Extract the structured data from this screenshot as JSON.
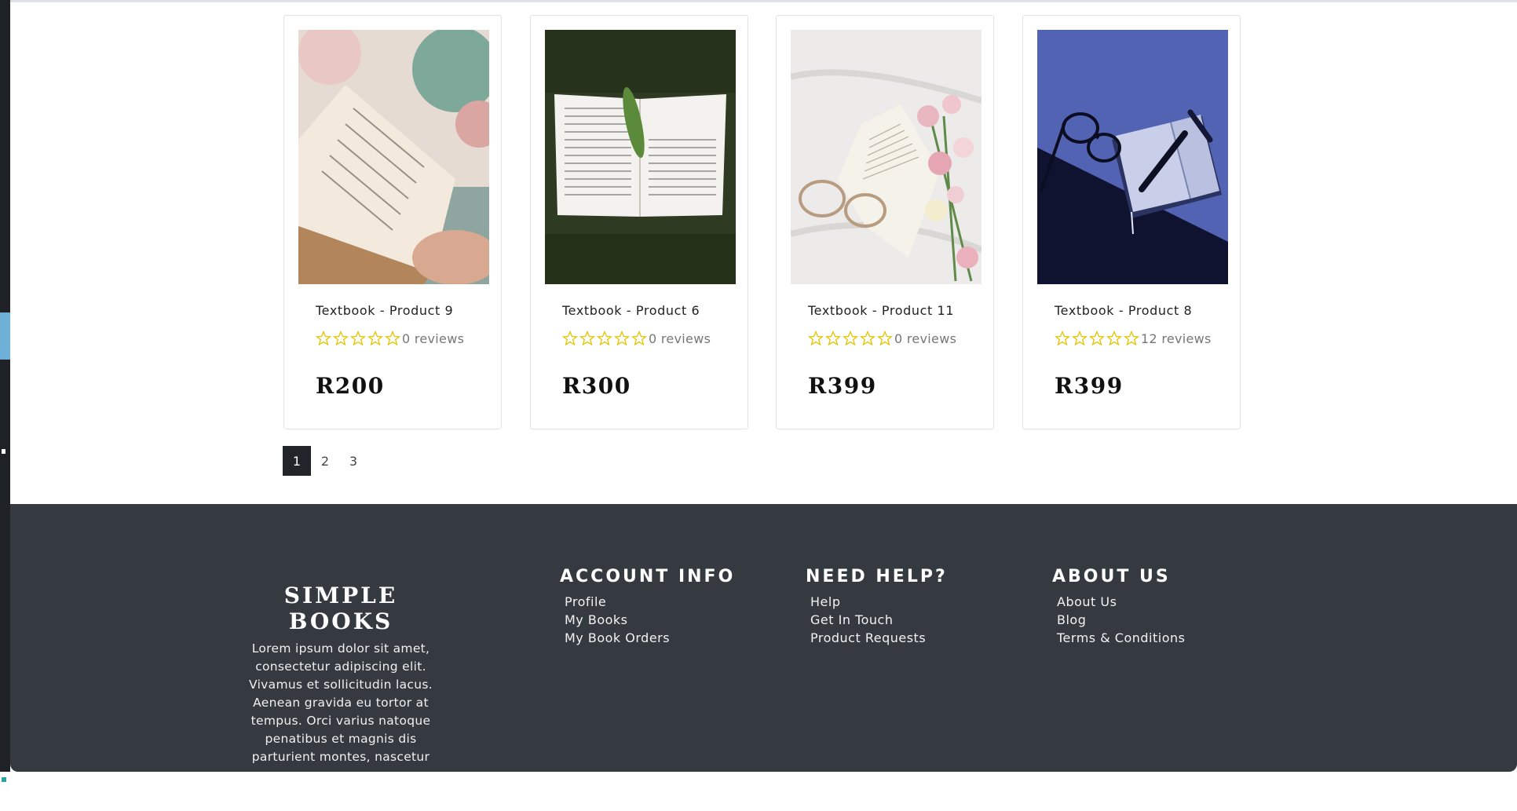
{
  "products": [
    {
      "title": "Textbook - Product 9",
      "reviews": "0 reviews",
      "price": "R200",
      "image": "photo-open-book-held-in-hand"
    },
    {
      "title": "Textbook - Product 6",
      "reviews": "0 reviews",
      "price": "R300",
      "image": "photo-open-book-on-grass-with-leaf"
    },
    {
      "title": "Textbook - Product 11",
      "reviews": "0 reviews",
      "price": "R399",
      "image": "photo-open-book-with-glasses-and-flowers"
    },
    {
      "title": "Textbook - Product 8",
      "reviews": "12 reviews",
      "price": "R399",
      "image": "photo-notebook-with-pen-and-glasses"
    }
  ],
  "pagination": {
    "pages": [
      "1",
      "2",
      "3"
    ],
    "active": "1"
  },
  "footer": {
    "brand": "SIMPLE BOOKS",
    "about_text": "Lorem ipsum dolor sit amet, consectetur adipiscing elit. Vivamus et sollicitudin lacus. Aenean gravida eu tortor at tempus. Orci varius natoque penatibus et magnis dis parturient montes, nascetur",
    "columns": [
      {
        "heading": "ACCOUNT INFO",
        "links": [
          "Profile",
          "My Books",
          "My Book Orders"
        ]
      },
      {
        "heading": "NEED HELP?",
        "links": [
          "Help",
          "Get In Touch",
          "Product Requests"
        ]
      },
      {
        "heading": "ABOUT US",
        "links": [
          "About Us",
          "Blog",
          "Terms & Conditions"
        ]
      }
    ]
  },
  "colors": {
    "star": "#e5c400",
    "footer_bg": "#343a40",
    "active_page": "#212529"
  },
  "icons": {
    "star": "star-outline-icon"
  }
}
